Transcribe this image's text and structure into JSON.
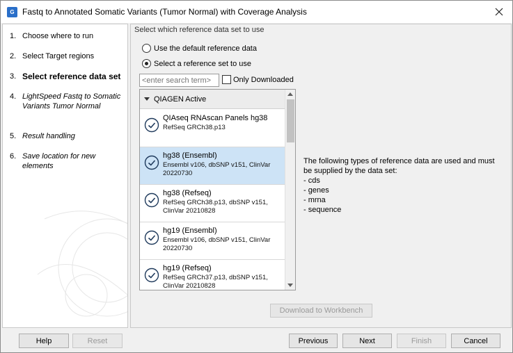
{
  "window": {
    "title": "Fastq to Annotated Somatic Variants (Tumor Normal) with Coverage Analysis",
    "app_icon_text": "G"
  },
  "steps": [
    {
      "num": "1.",
      "label": "Choose where to run",
      "state": "done"
    },
    {
      "num": "2.",
      "label": "Select Target regions",
      "state": "done"
    },
    {
      "num": "3.",
      "label": "Select reference data set",
      "state": "current"
    },
    {
      "num": "4.",
      "label": "LightSpeed Fastq to Somatic Variants Tumor Normal",
      "state": "future"
    },
    {
      "num": "5.",
      "label": "Result handling",
      "state": "future"
    },
    {
      "num": "6.",
      "label": "Save location for new elements",
      "state": "future"
    }
  ],
  "main": {
    "header": "Select which reference data set to use",
    "radio_default": "Use the default reference data",
    "radio_select": "Select a reference set to use",
    "radio_selected": "select",
    "search_placeholder": "<enter search term>",
    "only_downloaded_label": "Only Downloaded",
    "only_downloaded_checked": false,
    "group_label": "QIAGEN Active",
    "items": [
      {
        "name": "QIAseq RNAscan Panels hg38",
        "desc": "RefSeq GRCh38.p13",
        "selected": false
      },
      {
        "name": "hg38 (Ensembl)",
        "desc": "Ensembl v106, dbSNP v151, ClinVar 20220730",
        "selected": true
      },
      {
        "name": "hg38 (Refseq)",
        "desc": "RefSeq GRCh38.p13, dbSNP v151, ClinVar 20210828",
        "selected": false
      },
      {
        "name": "hg19 (Ensembl)",
        "desc": "Ensembl v106, dbSNP v151, ClinVar 20220730",
        "selected": false
      },
      {
        "name": "hg19 (Refseq)",
        "desc": "RefSeq GRCh37.p13, dbSNP v151, ClinVar 20210828",
        "selected": false
      }
    ],
    "info_lines": [
      "The following types of reference data are used and must",
      "be supplied by the data set:",
      "- cds",
      "- genes",
      "- mrna",
      "- sequence"
    ],
    "download_button": "Download to Workbench"
  },
  "footer": {
    "help": "Help",
    "reset": "Reset",
    "previous": "Previous",
    "next": "Next",
    "finish": "Finish",
    "cancel": "Cancel"
  },
  "colors": {
    "selection": "#cde3f6",
    "app_icon": "#2a6fc9"
  }
}
